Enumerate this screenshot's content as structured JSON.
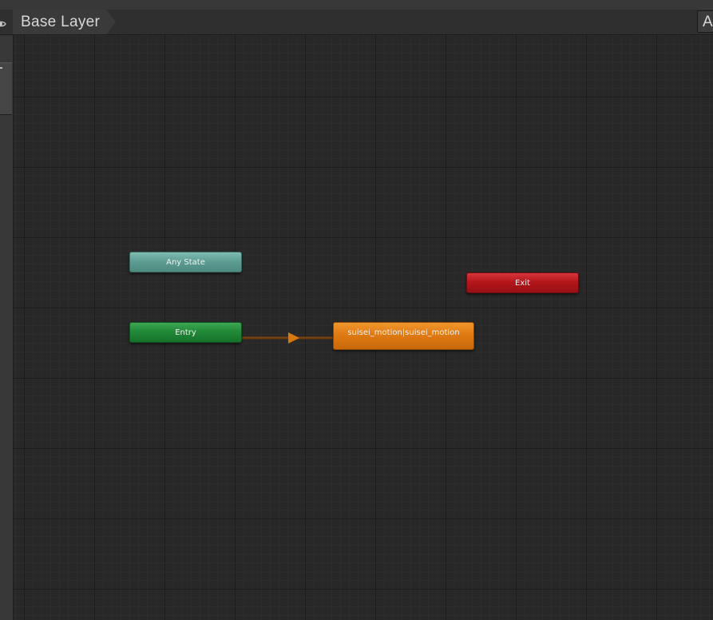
{
  "breadcrumb": {
    "layer_label": "Base Layer"
  },
  "toolbar": {
    "right_button_label": "Au"
  },
  "icons": {
    "visibility": "eye-icon",
    "transition_arrow": "arrow-right-icon"
  },
  "graph": {
    "nodes": {
      "any_state": "Any State",
      "entry": "Entry",
      "exit": "Exit",
      "default_state": "suisei_motion|suisei_motion"
    }
  },
  "colors": {
    "any_state": "#5e9e93",
    "entry": "#218a38",
    "exit": "#b4161b",
    "default_state": "#e07a12",
    "transition": "#8a4a0c"
  }
}
